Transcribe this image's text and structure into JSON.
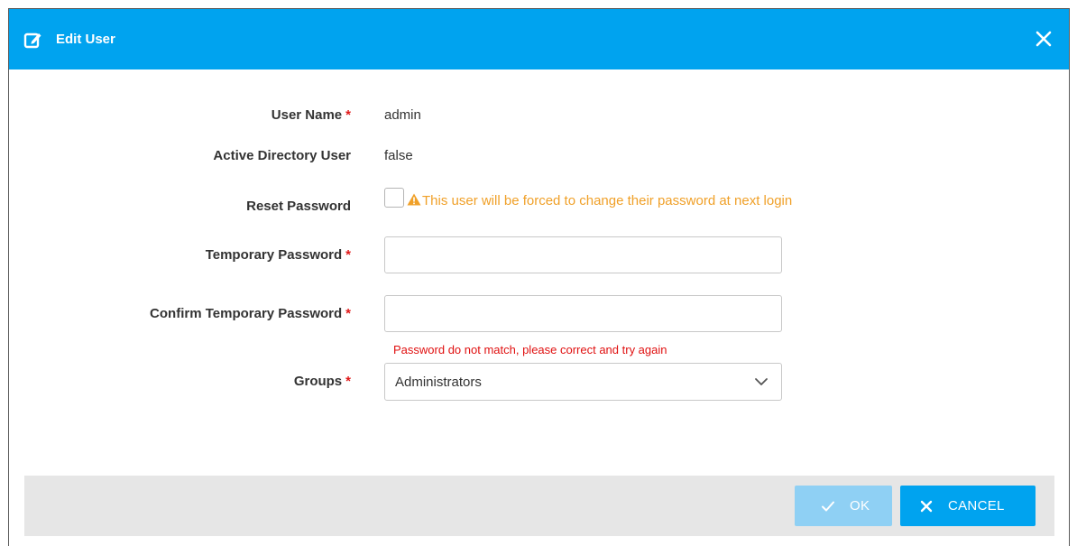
{
  "dialog": {
    "title": "Edit User",
    "title_icon": "edit-icon",
    "close_icon": "close-icon",
    "header_color": "#00a3ef"
  },
  "form": {
    "user_name": {
      "label": "User Name",
      "required_mark": "*",
      "value": "admin"
    },
    "ad_user": {
      "label": "Active Directory User",
      "value": "false"
    },
    "reset_password": {
      "label": "Reset Password",
      "checked": false,
      "warning_icon": "warning-icon",
      "warning": "This user will be forced to change their password at next login"
    },
    "temp_password": {
      "label": "Temporary Password",
      "required_mark": "*",
      "value": ""
    },
    "confirm_password": {
      "label": "Confirm Temporary Password",
      "required_mark": "*",
      "value": "",
      "error": "Password do not match, please correct and try again"
    },
    "groups": {
      "label": "Groups",
      "required_mark": "*",
      "selected": "Administrators",
      "chevron_icon": "chevron-down-icon"
    }
  },
  "footer": {
    "ok_label": "OK",
    "ok_icon": "check-icon",
    "cancel_label": "CANCEL",
    "cancel_icon": "close-icon"
  },
  "colors": {
    "primary": "#00a3ef",
    "primary_disabled": "#8fd0f4",
    "required": "#e01818",
    "warning": "#f0a028",
    "error": "#e01010",
    "footer_bg": "#e6e6e6"
  }
}
